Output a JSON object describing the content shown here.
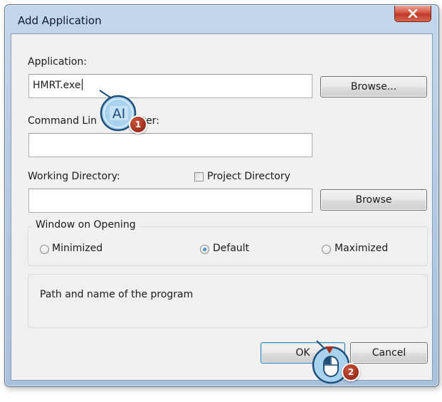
{
  "dialog": {
    "title": "Add Application",
    "close_glyph": "X"
  },
  "fields": {
    "application_label": "Application:",
    "application_value": "HMRT.exe",
    "browse1_label": "Browse...",
    "command_line_label_left": "Command Lin",
    "command_line_label_right": "eter:",
    "command_line_value": "",
    "working_dir_label": "Working Directory:",
    "project_dir_label": "Project Directory",
    "project_dir_checked": false,
    "working_dir_value": "",
    "browse2_label": "Browse"
  },
  "window_opening": {
    "legend": "Window on Opening",
    "options": [
      {
        "label": "Minimized",
        "selected": false
      },
      {
        "label": "Default",
        "selected": true
      },
      {
        "label": "Maximized",
        "selected": false
      }
    ]
  },
  "info": {
    "text": "Path and name of the program"
  },
  "buttons": {
    "ok": "OK",
    "cancel": "Cancel"
  },
  "callouts": {
    "step1_icon_text": "AI",
    "step1_number": "1",
    "step2_number": "2",
    "colors": {
      "callout_fill": "#a9d2ee",
      "callout_border": "#1f4e79",
      "badge": "#a8321f"
    }
  }
}
